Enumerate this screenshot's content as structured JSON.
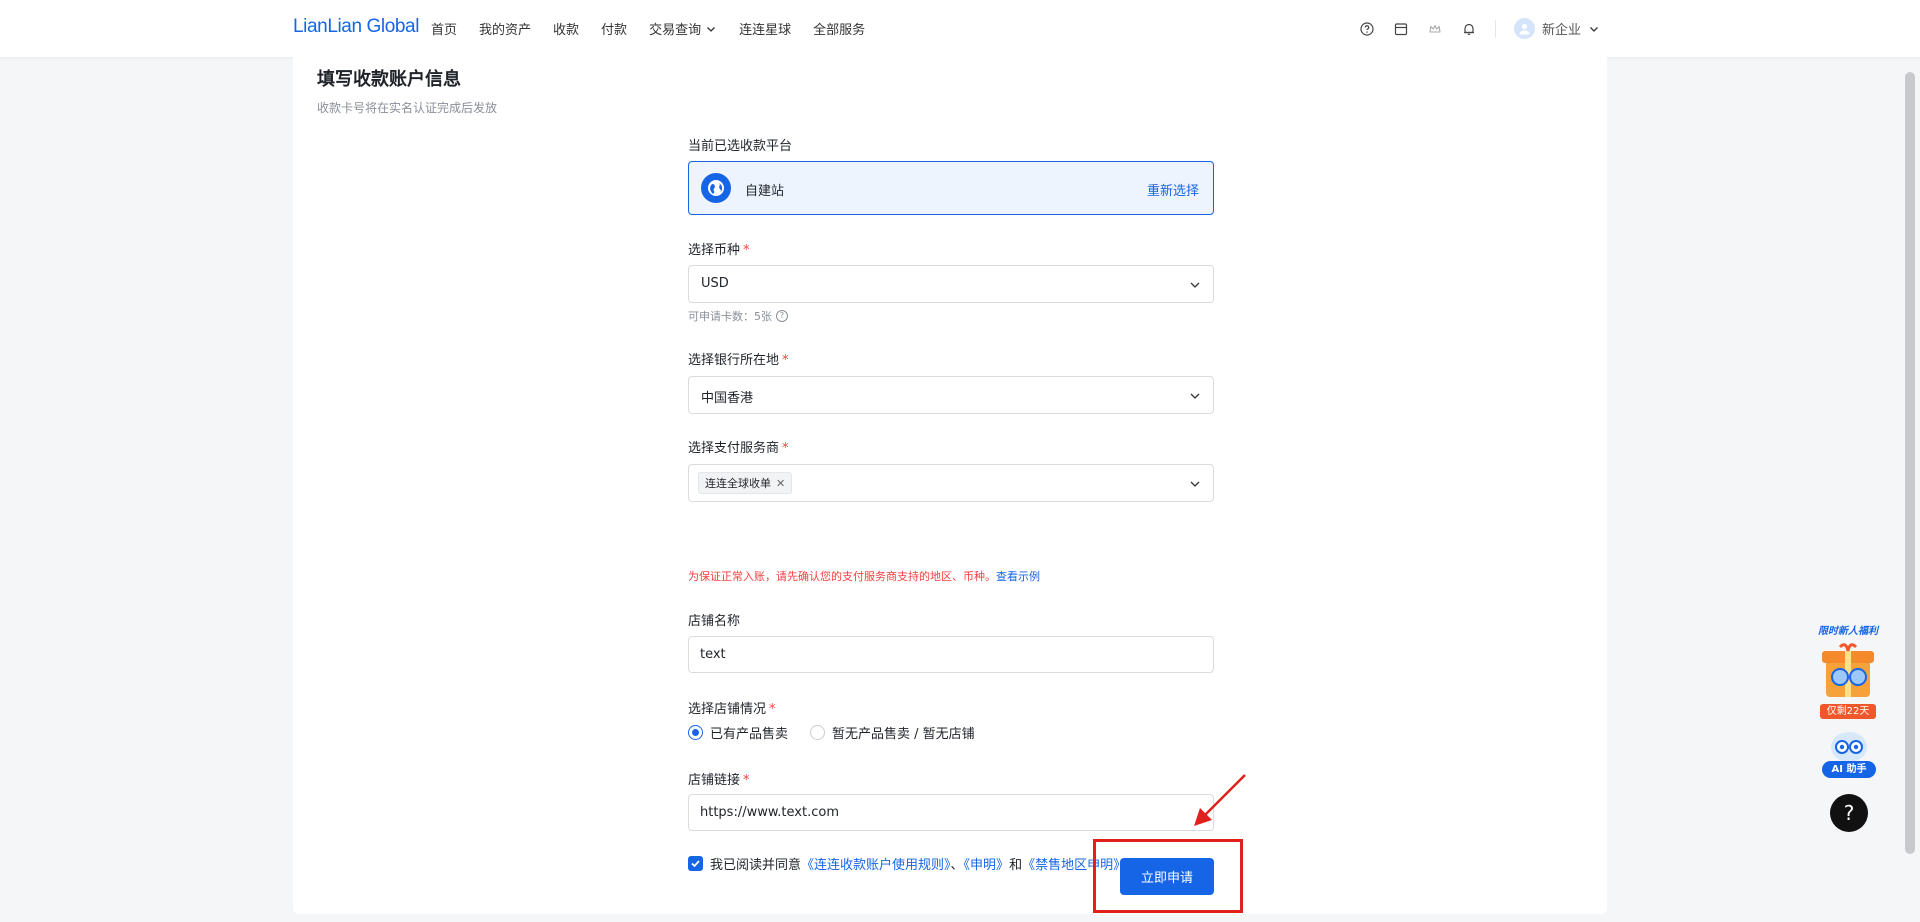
{
  "nav": {
    "logo": "LianLian Global",
    "items": [
      "首页",
      "我的资产",
      "收款",
      "付款",
      "交易查询",
      "连连星球",
      "全部服务"
    ],
    "user_name": "新企业"
  },
  "page": {
    "title": "填写收款账户信息",
    "subtitle": "收款卡号将在实名认证完成后发放"
  },
  "platform": {
    "label": "当前已选收款平台",
    "name": "自建站",
    "reselect": "重新选择"
  },
  "currency": {
    "label": "选择币种",
    "value": "USD",
    "hint": "可申请卡数：5张"
  },
  "bank_region": {
    "label": "选择银行所在地",
    "value": "中国香港"
  },
  "provider": {
    "label": "选择支付服务商",
    "tag": "连连全球收单",
    "warning": "为保证正常入账，请先确认您的支付服务商支持的地区、币种。",
    "warning_link": "查看示例"
  },
  "store_name": {
    "label": "店铺名称",
    "value": "text"
  },
  "store_status": {
    "label": "选择店铺情况",
    "options": [
      "已有产品售卖",
      "暂无产品售卖 / 暂无店铺"
    ],
    "selected": 0
  },
  "store_link": {
    "label": "店铺链接",
    "value": "https://www.text.com"
  },
  "agreement": {
    "prefix": "我已阅读并同意",
    "link1": "《连连收款账户使用规则》",
    "sep1": "、",
    "link2": "《申明》",
    "sep2": "和",
    "link3": "《禁售地区申明》"
  },
  "submit_label": "立即申请",
  "widgets": {
    "promo_title": "限时新人福利",
    "promo_badge": "仅剩22天",
    "ai_label": "AI 助手",
    "help": "?"
  },
  "colors": {
    "primary": "#1665e6",
    "required": "#f53f3f",
    "annotation": "#e0201c"
  }
}
